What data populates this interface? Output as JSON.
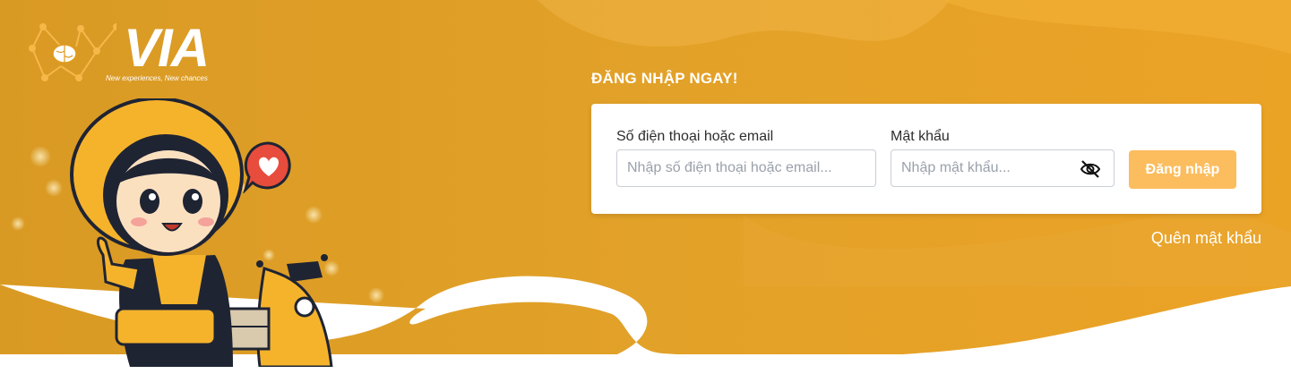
{
  "brand": {
    "logo_text": "VIA",
    "tagline": "New experiences, New chances"
  },
  "login": {
    "title": "ĐĂNG NHẬP NGAY!",
    "identifier_label": "Số điện thoại hoặc email",
    "identifier_placeholder": "Nhập số điện thoại hoặc email...",
    "identifier_value": "",
    "password_label": "Mật khẩu",
    "password_placeholder": "Nhập mật khẩu...",
    "password_value": "",
    "submit_label": "Đăng nhập",
    "forgot_label": "Quên mật khẩu"
  },
  "icons": {
    "password_toggle": "eye-off-icon",
    "logo_mark": "brain-network-icon",
    "mascot": "delivery-rider-illustration",
    "speech": "heart-speech-bubble-icon"
  },
  "colors": {
    "background": "#e3a127",
    "accent_light": "#f2b240",
    "button": "#fbbd5e",
    "card": "#ffffff",
    "input_border": "#c9ced6",
    "text": "#2d2d2d",
    "placeholder": "#9aa1ab"
  }
}
